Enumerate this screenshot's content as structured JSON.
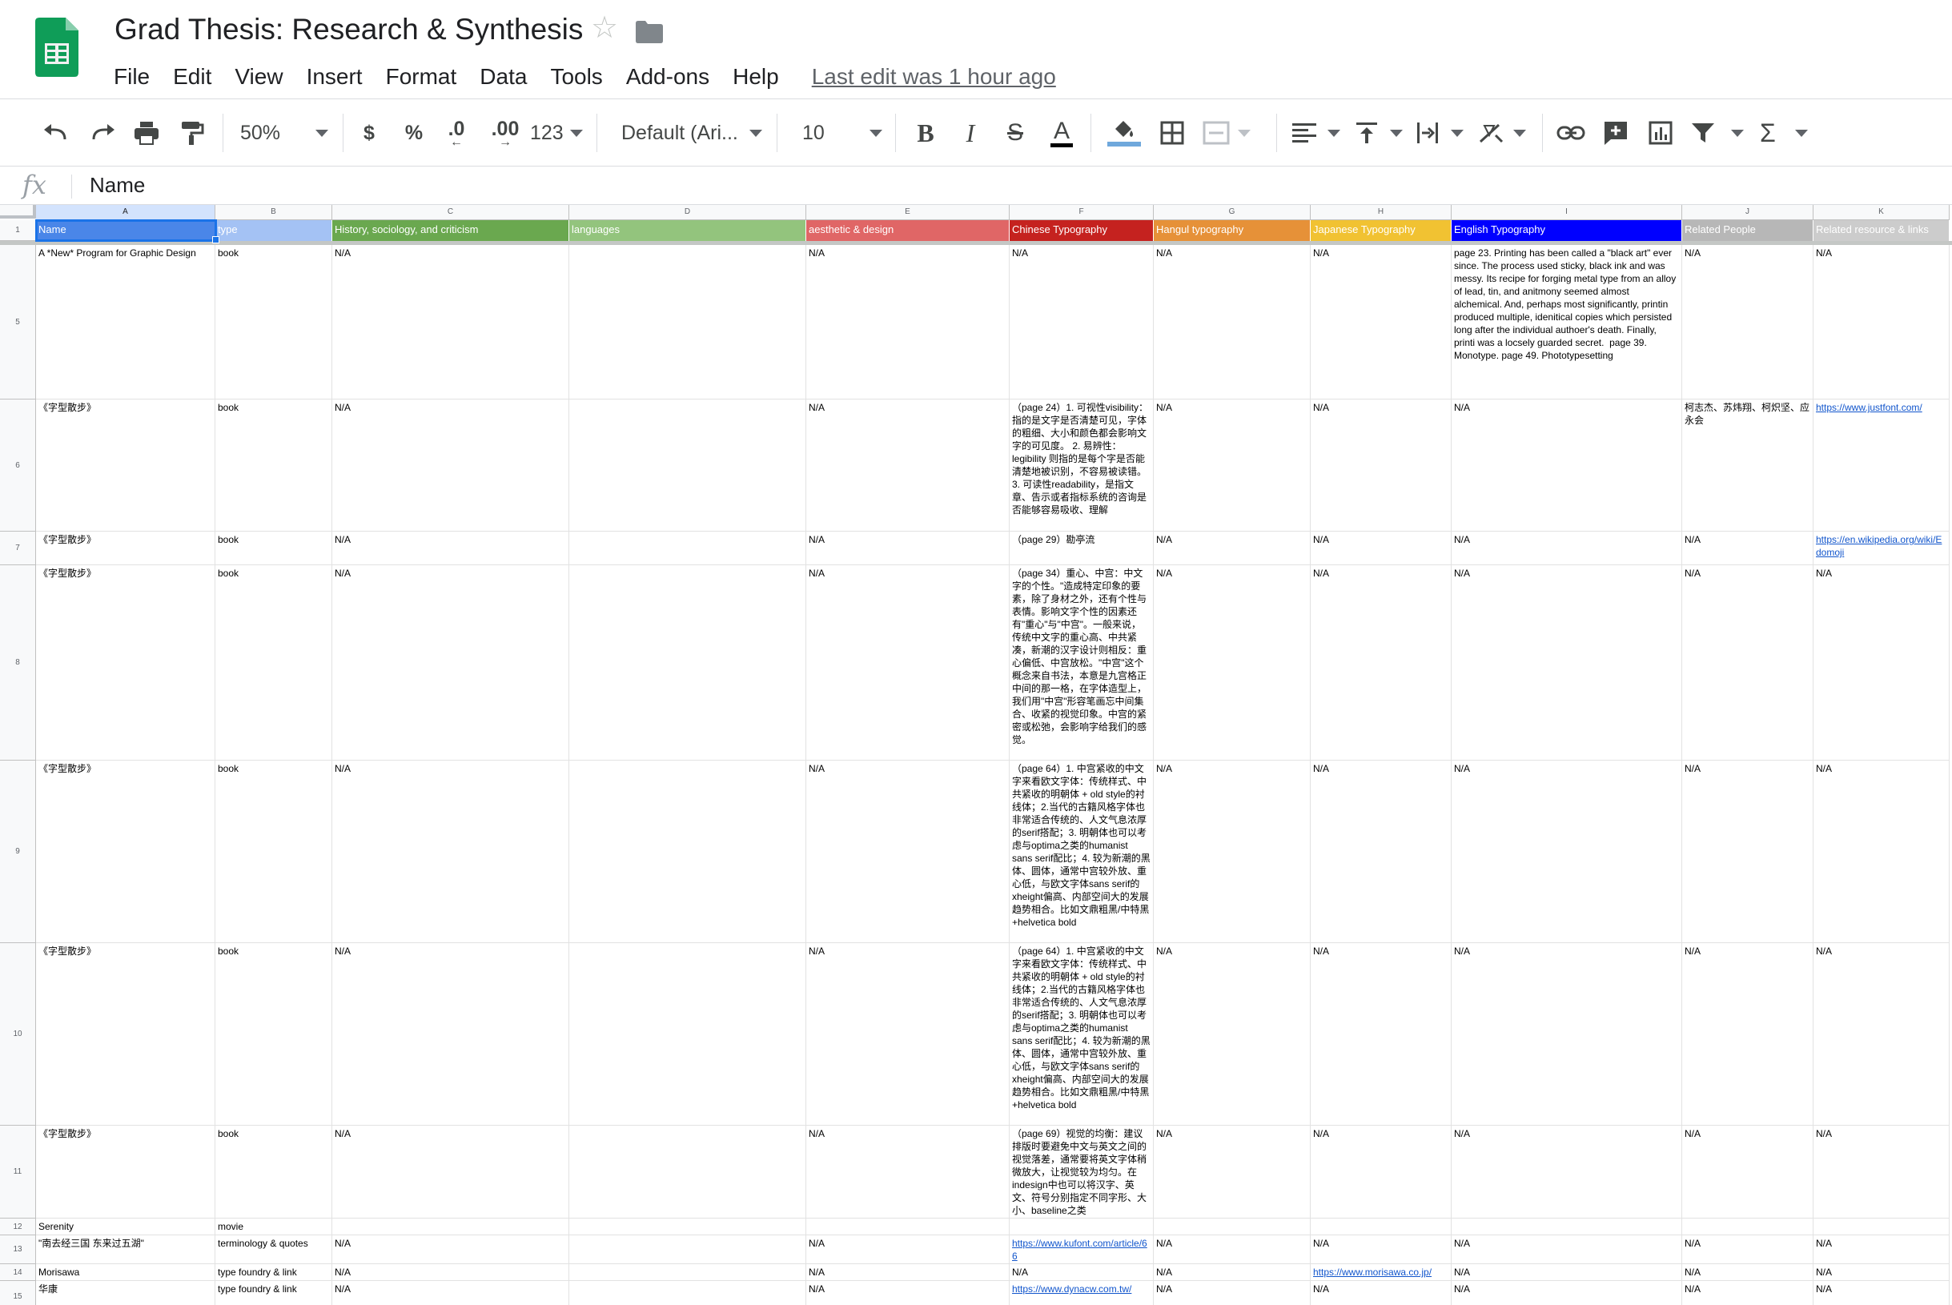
{
  "doc": {
    "title": "Grad Thesis: Research & Synthesis",
    "menu": [
      "File",
      "Edit",
      "View",
      "Insert",
      "Format",
      "Data",
      "Tools",
      "Add-ons",
      "Help"
    ],
    "last_edit": "Last edit was 1 hour ago"
  },
  "toolbar": {
    "zoom": "50%",
    "currency": "$",
    "percent": "%",
    "dec_decrease": ".0",
    "dec_increase": ".00",
    "more_formats": "123",
    "font": "Default (Ari...",
    "font_size": "10",
    "text_color_letter": "A"
  },
  "formula_bar": {
    "fx": "fx",
    "value": "Name"
  },
  "sheet": {
    "columns": [
      "A",
      "B",
      "C",
      "D",
      "E",
      "F",
      "G",
      "H",
      "I",
      "J",
      "K"
    ],
    "header_row_number": "1",
    "headers": [
      {
        "text": "Name",
        "color": "#4a86e8"
      },
      {
        "text": "type",
        "color": "#a4c2f4"
      },
      {
        "text": "History, sociology, and criticism",
        "color": "#6aa84f"
      },
      {
        "text": "languages",
        "color": "#93c47d"
      },
      {
        "text": "aesthetic & design",
        "color": "#e06666"
      },
      {
        "text": "Chinese Typography",
        "color": "#c5221f"
      },
      {
        "text": "Hangul typography",
        "color": "#e69138"
      },
      {
        "text": "Japanese Typography",
        "color": "#f1c232"
      },
      {
        "text": "English Typography",
        "color": "#0000ff"
      },
      {
        "text": "Related People",
        "color": "#b7b7b7"
      },
      {
        "text": "Related resource & links",
        "color": "#cccccc"
      }
    ],
    "rows": [
      {
        "num": "5",
        "cells": [
          "A *New* Program for Graphic Design",
          "book",
          "N/A",
          "",
          "N/A",
          "N/A",
          "N/A",
          "N/A",
          "page 23. Printing has been called a \"black art\" ever since. The process used sticky, black ink and was messy. Its recipe for forging metal type from an alloy of lead, tin, and anitmony seemed almost alchemical. And, perhaps most significantly, printin produced multiple, idenitical copies which persisted long after the individual authoer's death. Finally, printi was a locsely guarded secret.  page 39. Monotype. page 49. Phototypesetting",
          "N/A",
          "N/A"
        ]
      },
      {
        "num": "6",
        "cells": [
          "《字型散步》",
          "book",
          "N/A",
          "",
          "N/A",
          "（page 24）1. 可视性visibility：指的是文字是否清楚可见，字体的粗细、大小和颜色都会影响文字的可见度。 2. 易辨性：legibility 则指的是每个字是否能清楚地被识别，不容易被读错。3. 可读性readability，是指文章、告示或者指标系统的咨询是否能够容易吸收、理解",
          "N/A",
          "N/A",
          "N/A",
          "柯志杰、苏炜翔、柯炽坚、应永会",
          "https://www.justfont.com/"
        ]
      },
      {
        "num": "7",
        "cells": [
          "《字型散步》",
          "book",
          "N/A",
          "",
          "N/A",
          "（page 29）勘亭流",
          "N/A",
          "N/A",
          "N/A",
          "N/A",
          "https://en.wikipedia.org/wiki/Edomoji"
        ]
      },
      {
        "num": "8",
        "cells": [
          "《字型散步》",
          "book",
          "N/A",
          "",
          "N/A",
          "（page 34）重心、中宫：中文字的个性。\"造成特定印象的要素，除了身材之外，还有个性与表情。影响文字个性的因素还有\"重心\"与\"中宫\"。一般来说，传统中文字的重心高、中共紧凑，新潮的汉字设计则相反：重心偏低、中宫放松。\"中宫\"这个概念来自书法，本意是九宫格正中间的那一格，在字体造型上，我们用\"中宫\"形容笔画忘中间集合、收紧的视觉印象。中宫的紧密或松弛，会影响字给我们的感觉。",
          "N/A",
          "N/A",
          "N/A",
          "N/A",
          "N/A"
        ]
      },
      {
        "num": "9",
        "cells": [
          "《字型散步》",
          "book",
          "N/A",
          "",
          "N/A",
          "（page 64）1. 中宫紧收的中文字来看欧文字体：传统样式、中共紧收的明朝体 + old style的衬线体；2.当代的古籍风格字体也非常适合传统的、人文气息浓厚的serif搭配；3. 明朝体也可以考虑与optima之类的humanist sans serif配比；4. 较为新潮的黑体、圆体，通常中宫较外放、重心低，与欧文字体sans serif的xheight偏高、内部空间大的发展趋势相合。比如文鼎粗黑/中特黑+helvetica bold",
          "N/A",
          "N/A",
          "N/A",
          "N/A",
          "N/A"
        ]
      },
      {
        "num": "10",
        "cells": [
          "《字型散步》",
          "book",
          "N/A",
          "",
          "N/A",
          "（page 64）1. 中宫紧收的中文字来看欧文字体：传统样式、中共紧收的明朝体 + old style的衬线体；2.当代的古籍风格字体也非常适合传统的、人文气息浓厚的serif搭配；3. 明朝体也可以考虑与optima之类的humanist sans serif配比；4. 较为新潮的黑体、圆体，通常中宫较外放、重心低，与欧文字体sans serif的xheight偏高、内部空间大的发展趋势相合。比如文鼎粗黑/中特黑+helvetica bold",
          "N/A",
          "N/A",
          "N/A",
          "N/A",
          "N/A"
        ]
      },
      {
        "num": "11",
        "cells": [
          "《字型散步》",
          "book",
          "N/A",
          "",
          "N/A",
          "（page 69）视觉的均衡：建议排版时要避免中文与英文之间的视觉落差，通常要将英文字体稍微放大，让视觉较为均匀。在indesign中也可以将汉字、英文、符号分别指定不同字形、大小、baseline之类",
          "N/A",
          "N/A",
          "N/A",
          "N/A",
          "N/A"
        ]
      },
      {
        "num": "12",
        "cells": [
          "Serenity",
          "movie",
          "",
          "",
          "",
          "",
          "",
          "",
          "",
          "",
          ""
        ]
      },
      {
        "num": "13",
        "cells": [
          "\"南去经三国 东来过五湖\"",
          "terminology & quotes",
          "N/A",
          "",
          "N/A",
          "https://www.kufont.com/article/66",
          "N/A",
          "N/A",
          "N/A",
          "N/A",
          "N/A"
        ]
      },
      {
        "num": "14",
        "cells": [
          "Morisawa",
          "type foundry & link",
          "N/A",
          "",
          "N/A",
          "N/A",
          "N/A",
          "https://www.morisawa.co.jp/",
          "N/A",
          "N/A",
          "N/A"
        ]
      },
      {
        "num": "15",
        "cells": [
          "华康",
          "type foundry & link",
          "N/A",
          "",
          "N/A",
          "https://www.dynacw.com.tw/",
          "N/A",
          "N/A",
          "N/A",
          "N/A",
          "N/A"
        ]
      }
    ]
  }
}
